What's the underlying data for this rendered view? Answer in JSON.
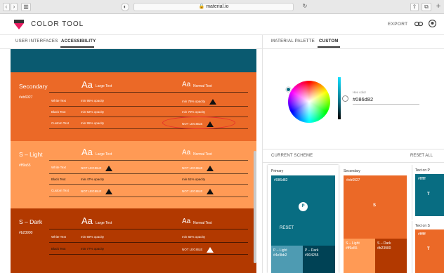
{
  "browser": {
    "url": "material.io"
  },
  "app": {
    "title": "COLOR TOOL",
    "export": "EXPORT"
  },
  "left_tabs": [
    {
      "label": "USER INTERFACES"
    },
    {
      "label": "ACCESSIBILITY"
    }
  ],
  "right_tabs": [
    {
      "label": "MATERIAL PALETTE"
    },
    {
      "label": "CUSTOM"
    }
  ],
  "large_text": "Large Text",
  "normal_text": "Normal Text",
  "aa": "Aa",
  "sections": [
    {
      "name": "Secondary",
      "hex": "#eb6927",
      "color": "#eb6927",
      "rows": [
        {
          "label": "White Text",
          "large": "min 95% opacity",
          "normal": "min 76% opacity",
          "normal_warn": true
        },
        {
          "label": "Black Text",
          "large": "min 52% opacity",
          "normal": "min 70% opacity"
        },
        {
          "label": "Custom Text",
          "large": "min 95% opacity",
          "normal": "NOT LEGIBLE",
          "normal_warn": true
        }
      ]
    },
    {
      "name": "S – Light",
      "hex": "#ff9a55",
      "color": "#ff9a55",
      "rows": [
        {
          "label": "White Text",
          "large": "NOT LEGIBLE",
          "normal": "NOT LEGIBLE",
          "large_warn": true,
          "normal_warn": true
        },
        {
          "label": "Black Text",
          "large": "min 47% opacity",
          "normal": "min 61% opacity"
        },
        {
          "label": "Custom Text",
          "large": "NOT LEGIBLE",
          "normal": "NOT LEGIBLE",
          "large_warn": true,
          "normal_warn": true
        }
      ]
    },
    {
      "name": "S – Dark",
      "hex": "#b23900",
      "color": "#b23900",
      "rows": [
        {
          "label": "White Text",
          "large": "min 59% opacity",
          "normal": "min 82% opacity"
        },
        {
          "label": "Black Text",
          "large": "min 77% opacity",
          "normal": "NOT LEGIBLE",
          "normal_warn": true
        }
      ]
    }
  ],
  "picker": {
    "hex_label": "Hex color",
    "hex_value": "#086d82"
  },
  "scheme": {
    "title": "CURRENT SCHEME",
    "reset_all": "RESET ALL",
    "primary": {
      "label": "Primary",
      "hex": "#086d82",
      "center": "P",
      "reset": "RESET",
      "light_label": "P – Light",
      "light_hex": "#4e9bb2",
      "dark_label": "P – Dark",
      "dark_hex": "#004255"
    },
    "secondary": {
      "label": "Secondary",
      "hex": "#eb6927",
      "center": "S",
      "light_label": "S – Light",
      "light_hex": "#ff9a55",
      "dark_label": "S – Dark",
      "dark_hex": "#b23900"
    },
    "text_on_p": {
      "label": "Text on P",
      "hex": "#ffffff",
      "center": "T"
    },
    "text_on_s": {
      "label": "Text on S",
      "hex": "#ffffff",
      "center": "T"
    }
  }
}
